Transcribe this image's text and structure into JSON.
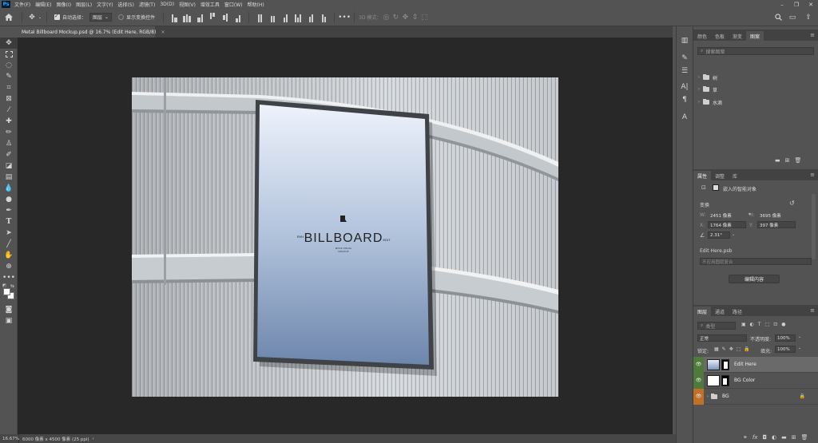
{
  "menubar": {
    "app_logo": "Ps",
    "items": [
      "文件(F)",
      "编辑(E)",
      "图像(I)",
      "图层(L)",
      "文字(Y)",
      "选择(S)",
      "滤镜(T)",
      "3D(D)",
      "视图(V)",
      "增效工具",
      "窗口(W)",
      "帮助(H)"
    ]
  },
  "options": {
    "auto_select_label": "自动选择：",
    "auto_select_value": "图层",
    "show_transform_label": "显示变换控件",
    "mode_3d_label": "3D 模式："
  },
  "document": {
    "tab_title": "Metal Billboard Mockup.psd @ 16.7% (Edit Here, RGB/8)",
    "tab_close": "×",
    "billboard_brand_left": "RVH",
    "billboard_brand_right": "EDIT",
    "billboard_title": "BILLBOARD",
    "billboard_sub1": "MOCK VISUAL",
    "billboard_sub2": "MOCKUP"
  },
  "status": {
    "zoom": "16.67%",
    "doc_info": "6000 像素 x 4500 像素 (25 ppi)",
    "arrow": "›"
  },
  "library_panel": {
    "tabs": [
      "颜色",
      "色板",
      "渐变",
      "图案"
    ],
    "active_tab": "图案",
    "search_placeholder": "搜索图案",
    "items": [
      "树",
      "草",
      "水滴"
    ]
  },
  "properties_panel": {
    "tabs": [
      "属性",
      "调整",
      "库"
    ],
    "active_tab": "属性",
    "object_type": "嵌入的智能对象",
    "transform_label": "变换",
    "w_label": "W:",
    "w_value": "2451 像素",
    "h_label": "H:",
    "h_value": "3695 像素",
    "x_label": "X:",
    "x_value": "1764 像素",
    "y_label": "Y:",
    "y_value": "397 像素",
    "angle_value": "2.31°",
    "file_name": "Edit Here.psb",
    "layer_comp_placeholder": "不应用图层复合",
    "edit_button": "编辑内容"
  },
  "layers_panel": {
    "tabs": [
      "图层",
      "通道",
      "路径"
    ],
    "active_tab": "图层",
    "filter_placeholder": "类型",
    "blend_mode": "正常",
    "opacity_label": "不透明度:",
    "opacity_value": "100%",
    "lock_label": "锁定:",
    "fill_label": "填充:",
    "fill_value": "100%",
    "layers": [
      {
        "name": "Edit Here",
        "selected": true,
        "eye": "green"
      },
      {
        "name": "BG Color",
        "selected": false,
        "eye": "green"
      },
      {
        "name": "BG",
        "selected": false,
        "eye": "orange"
      }
    ]
  },
  "colors": {
    "workspace_bg": "#535353",
    "canvas_bg": "#282828",
    "eye_green": "#4e7a3a",
    "eye_orange": "#c27025"
  }
}
